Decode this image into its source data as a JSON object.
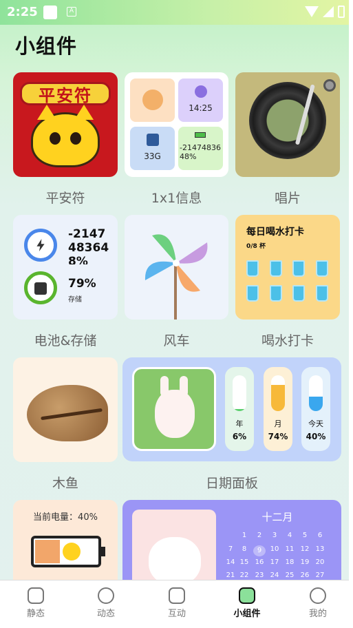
{
  "status_bar": {
    "time": "2:25"
  },
  "page": {
    "title": "小组件"
  },
  "widgets": {
    "pinganfu": {
      "label": "平安符",
      "banner": "平安符"
    },
    "info": {
      "label": "1x1信息",
      "time": "14:25",
      "storage": "33G",
      "battery_line1": "-21474836",
      "battery_line2": "48%"
    },
    "record": {
      "label": "唱片"
    },
    "battery_storage": {
      "label": "电池&存储",
      "battery_line1": "-2147",
      "battery_line2": "48364",
      "battery_line3": "8%",
      "storage_percent": "79%",
      "storage_label": "存储"
    },
    "windmill": {
      "label": "风车"
    },
    "water": {
      "label": "喝水打卡",
      "title": "每日喝水打卡",
      "progress": "0/8",
      "unit": "杯"
    },
    "muyu": {
      "label": "木鱼"
    },
    "date_panel": {
      "label": "日期面板",
      "bars": [
        {
          "name": "年",
          "value": "6%",
          "fill": 0.06,
          "color": "#5ccf6e",
          "bg": "#e4f5ea"
        },
        {
          "name": "月",
          "value": "74%",
          "fill": 0.74,
          "color": "#f7b93a",
          "bg": "#fdf0d6"
        },
        {
          "name": "今天",
          "value": "40%",
          "fill": 0.4,
          "color": "#3aa7ee",
          "bg": "#e4f1fb"
        }
      ]
    },
    "power": {
      "text": "当前电量：40%"
    },
    "calendar": {
      "month": "十二月",
      "rows": [
        [
          "",
          "",
          "1",
          "2",
          "3",
          "4",
          "5",
          "6"
        ],
        [
          "7",
          "8",
          "9",
          "10",
          "11",
          "12",
          "13"
        ],
        [
          "14",
          "15",
          "16",
          "17",
          "18",
          "19",
          "20"
        ],
        [
          "21",
          "22",
          "23",
          "24",
          "25",
          "26",
          "27"
        ]
      ]
    }
  },
  "nav": [
    {
      "label": "静态",
      "icon": "image-icon"
    },
    {
      "label": "动态",
      "icon": "smile-icon"
    },
    {
      "label": "互动",
      "icon": "bolt-icon"
    },
    {
      "label": "小组件",
      "icon": "widget-icon",
      "active": true
    },
    {
      "label": "我的",
      "icon": "face-icon"
    }
  ]
}
